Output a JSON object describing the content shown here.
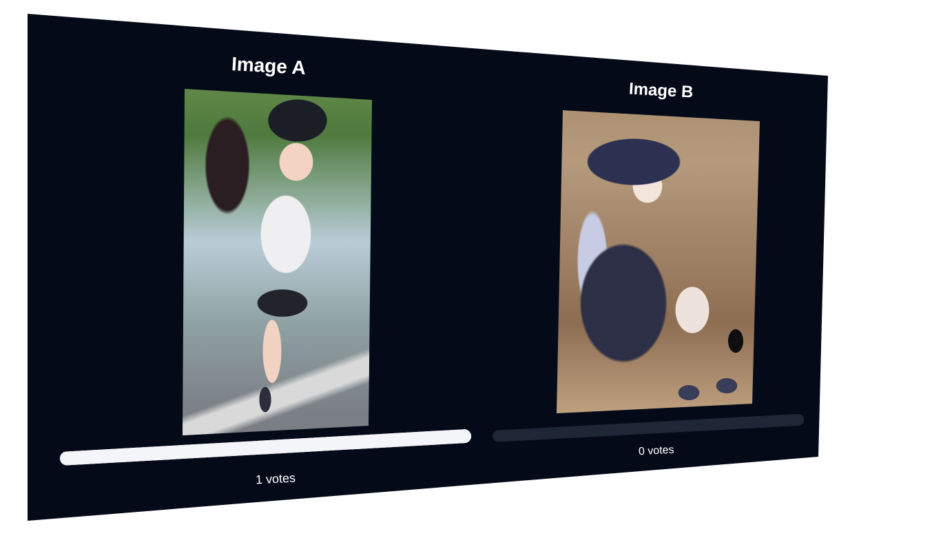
{
  "options": [
    {
      "title": "Image A",
      "votes_label": "1 votes",
      "votes": 1,
      "bar_fill_fraction": 1.0,
      "image_alt": "Anime girl in black cap and white tank top running on a road"
    },
    {
      "title": "Image B",
      "votes_label": "0 votes",
      "votes": 0,
      "bar_fill_fraction": 0.0,
      "image_alt": "Anime witch girl with silver hair sitting on cobblestone street with black cat"
    }
  ],
  "colors": {
    "background": "#050a18",
    "bar_filled": "#f4f5f8",
    "bar_empty": "#1f2636",
    "text": "#ffffff"
  }
}
